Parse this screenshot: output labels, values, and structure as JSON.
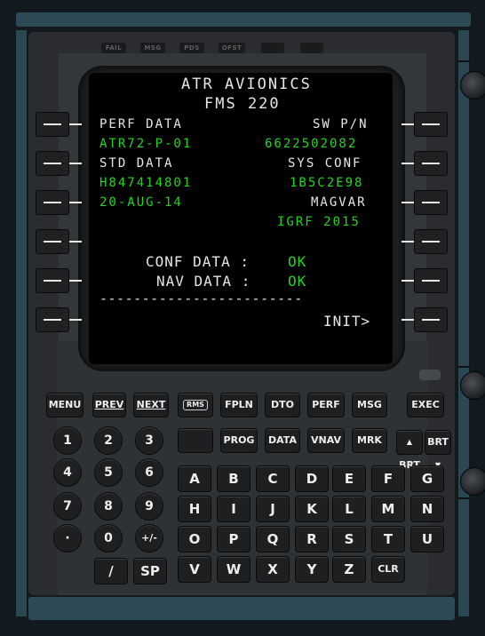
{
  "annunciators": [
    "FAIL",
    "MSG",
    "PDS",
    "OFST",
    "",
    ""
  ],
  "screen": {
    "title1": "ATR AVIONICS",
    "title2": "FMS 220",
    "perf_label": "PERF DATA",
    "sw_label": "SW P/N",
    "perf_value": "ATR72-P-01",
    "sw_value": "6622502082",
    "std_label": "STD DATA",
    "sys_label": "SYS CONF",
    "std_value": "H847414801",
    "sys_value": "1B5C2E98",
    "date_value": "20-AUG-14",
    "magvar_label": "MAGVAR",
    "magvar_value": "IGRF 2015",
    "conf_label": "CONF DATA :",
    "conf_value": "OK",
    "nav_label": "NAV DATA :",
    "nav_value": "OK",
    "divider": "------------------------",
    "init_prompt": "INIT>"
  },
  "function_keys": {
    "menu": "MENU",
    "prev": "PREV",
    "next": "NEXT",
    "rms": "RMS",
    "fpln": "FPLN",
    "dto": "DTO",
    "perf": "PERF",
    "msg": "MSG",
    "exec": "EXEC",
    "prog": "PROG",
    "data": "DATA",
    "vnav": "VNAV",
    "mrk": "MRK",
    "brt_up": "BRT",
    "brt_down": "BRT"
  },
  "keypad": {
    "numbers": [
      "1",
      "2",
      "3",
      "4",
      "5",
      "6",
      "7",
      "8",
      "9",
      "·",
      "0",
      "+/-"
    ],
    "slash": "/",
    "sp": "SP",
    "clr": "CLR",
    "letters": [
      "A",
      "B",
      "C",
      "D",
      "E",
      "F",
      "G",
      "H",
      "I",
      "J",
      "K",
      "L",
      "M",
      "N",
      "O",
      "P",
      "Q",
      "R",
      "S",
      "T",
      "U",
      "V",
      "W",
      "X",
      "Y",
      "Z"
    ]
  }
}
